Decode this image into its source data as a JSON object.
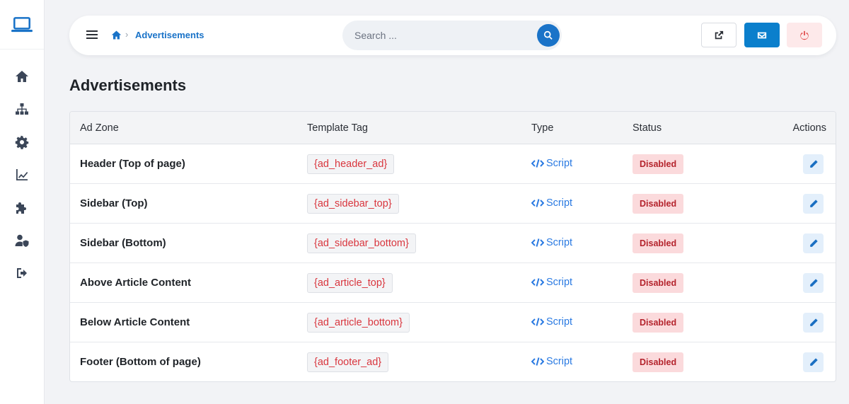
{
  "sidebar": {
    "brand_icon": "laptop-icon",
    "items": [
      {
        "icon": "home-icon"
      },
      {
        "icon": "sitemap-icon"
      },
      {
        "icon": "gear-icon"
      },
      {
        "icon": "chart-line-icon"
      },
      {
        "icon": "puzzle-icon"
      },
      {
        "icon": "user-shield-icon"
      },
      {
        "icon": "sign-out-icon"
      }
    ]
  },
  "topbar": {
    "breadcrumb": {
      "current": "Advertisements",
      "separator": "›"
    },
    "search": {
      "placeholder": "Search ..."
    },
    "colors": {
      "accent": "#0b7fcc",
      "danger_bg": "#fde9ea"
    }
  },
  "page": {
    "title": "Advertisements"
  },
  "table": {
    "headers": {
      "zone": "Ad Zone",
      "tag": "Template Tag",
      "type": "Type",
      "status": "Status",
      "actions": "Actions"
    },
    "rows": [
      {
        "zone": "Header (Top of page)",
        "tag": "{ad_header_ad}",
        "type": "Script",
        "status": "Disabled"
      },
      {
        "zone": "Sidebar (Top)",
        "tag": "{ad_sidebar_top}",
        "type": "Script",
        "status": "Disabled"
      },
      {
        "zone": "Sidebar (Bottom)",
        "tag": "{ad_sidebar_bottom}",
        "type": "Script",
        "status": "Disabled"
      },
      {
        "zone": "Above Article Content",
        "tag": "{ad_article_top}",
        "type": "Script",
        "status": "Disabled"
      },
      {
        "zone": "Below Article Content",
        "tag": "{ad_article_bottom}",
        "type": "Script",
        "status": "Disabled"
      },
      {
        "zone": "Footer (Bottom of page)",
        "tag": "{ad_footer_ad}",
        "type": "Script",
        "status": "Disabled"
      }
    ]
  }
}
